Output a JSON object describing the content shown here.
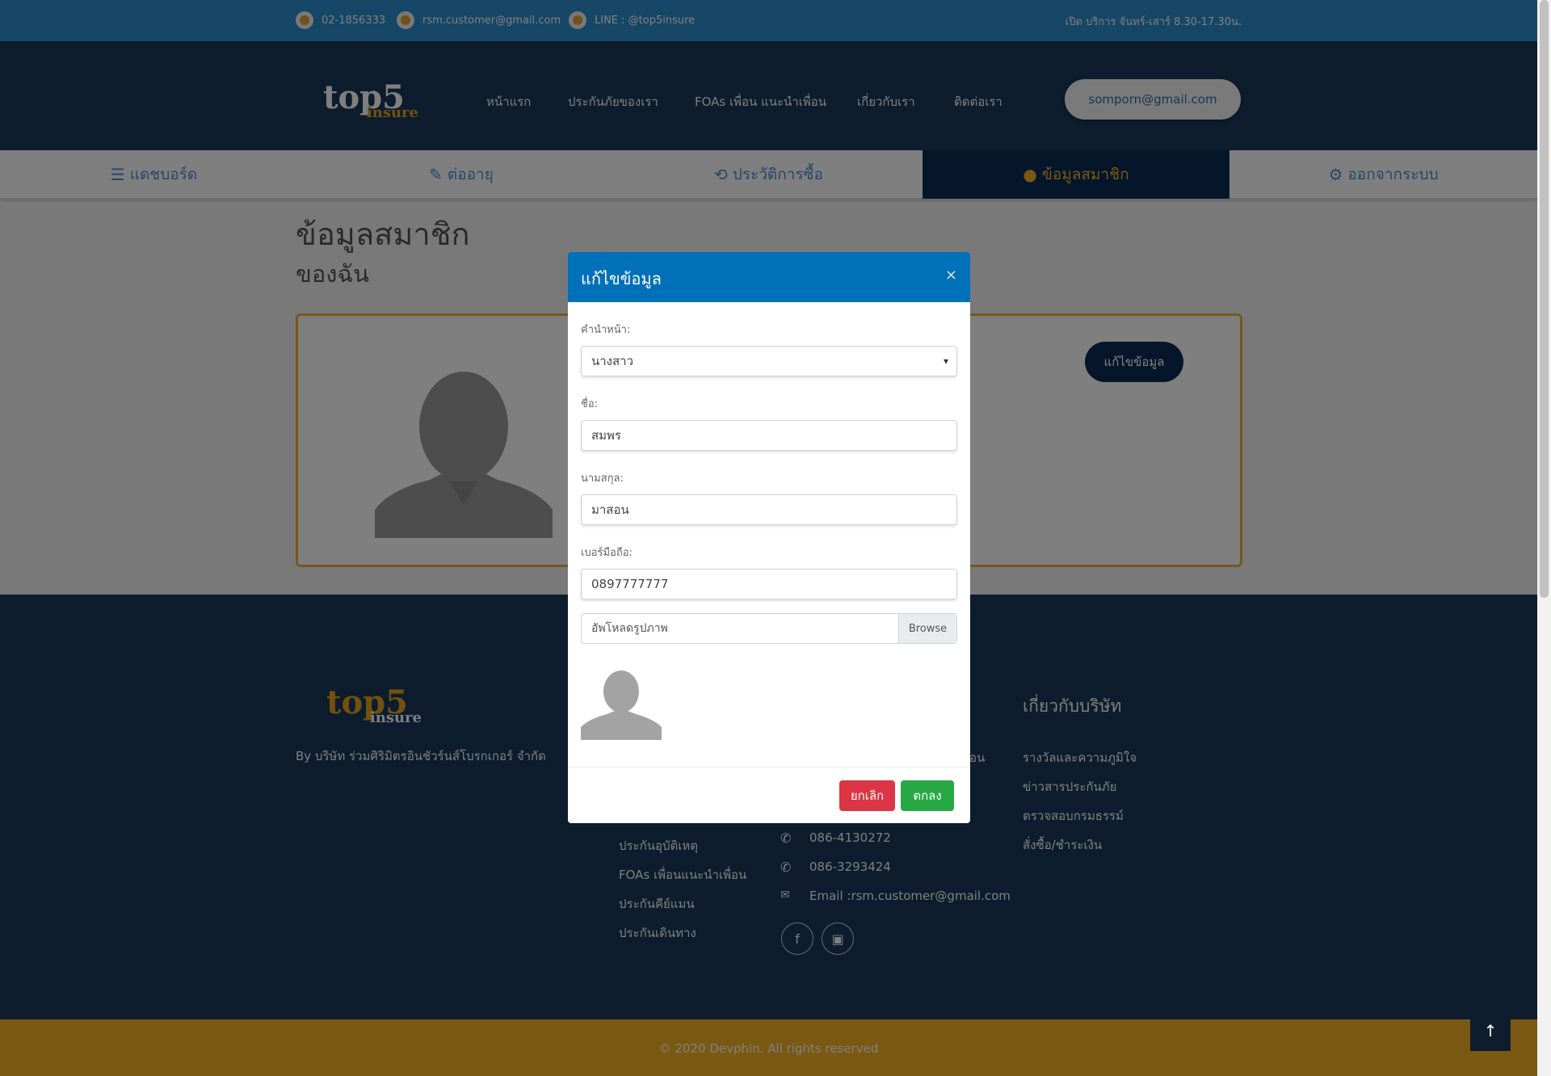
{
  "topbar": {
    "phone": "02-1856333",
    "email": "rsm.customer@gmail.com",
    "line": "LINE : @top5insure",
    "hours": "เปิด บริการ จันทร์-เสาร์ 8.30-17.30น."
  },
  "header": {
    "logo_top": "top5",
    "logo_bottom": "insure",
    "nav": [
      "หน้าแรก",
      "ประกันภัยของเรา",
      "FOAs เพื่อน แนะนำเพื่อน",
      "เกี่ยวกับเรา",
      "ติดต่อเรา"
    ],
    "user_email": "somporn@gmail.com"
  },
  "tabs": [
    {
      "label": "แดชบอร์ด",
      "icon": "list-icon"
    },
    {
      "label": "ต่ออายุ",
      "icon": "edit-icon"
    },
    {
      "label": "ประวัติการซื้อ",
      "icon": "history-icon"
    },
    {
      "label": "ข้อมูลสมาชิก",
      "icon": "user-icon"
    },
    {
      "label": "ออกจากระบบ",
      "icon": "gear-icon"
    }
  ],
  "page": {
    "title": "ข้อมูลสมาชิก",
    "subtitle": "ของฉัน",
    "edit_button": "แก้ไขข้อมูล"
  },
  "modal": {
    "title": "แก้ไขข้อมูล",
    "close": "×",
    "prefix_label": "คำนำหน้า:",
    "prefix_value": "นางสาว",
    "firstname_label": "ชื่อ:",
    "firstname_value": "สมพร",
    "lastname_label": "นามสกุล:",
    "lastname_value": "มาสอน",
    "mobile_label": "เบอร์มือถือ:",
    "mobile_value": "0897777777",
    "upload_placeholder": "อัพโหลดรูปภาพ",
    "browse_label": "Browse",
    "cancel_label": "ยกเลิก",
    "ok_label": "ตกลง"
  },
  "footer": {
    "logo_top": "top5",
    "logo_bottom": "insure",
    "by": "By บริษัท ร่วมศิริมิตรอินชัวร์นส์โบรกเกอร์ จำกัด",
    "partial_link": "อน",
    "insurance_links": [
      "ประกันอุบัติเหตุ",
      "FOAs เพื่อนแนะนำเพื่อน",
      "ประกันคีย์แมน",
      "ประกันเดินทาง"
    ],
    "contacts": [
      "086-4130272",
      "086-3293424",
      "Email :rsm.customer@gmail.com"
    ],
    "about_heading": "เกี่ยวกับบริษัท",
    "about_links": [
      "รางวัลและความภูมิใจ",
      "ข่าวสารประกันภัย",
      "ตรวจสอบกรมธรรม์",
      "สั่งซื้อ/ชำระเงิน"
    ],
    "copyright": "© 2020 Devphin. All rights reserved"
  },
  "colors": {
    "topbar": "#2f8fcf",
    "header": "#1a3a5c",
    "active_tab": "#0d2d55",
    "accent": "#f5b324",
    "modal_header": "#0070b8",
    "cancel": "#dc3545",
    "ok": "#28a745"
  }
}
